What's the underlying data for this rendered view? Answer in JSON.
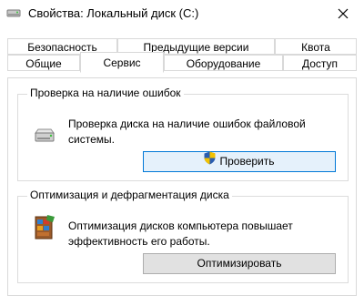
{
  "window": {
    "title": "Свойства: Локальный диск (C:)"
  },
  "tabs": {
    "row_back": [
      {
        "label": "Безопасность"
      },
      {
        "label": "Предыдущие версии"
      },
      {
        "label": "Квота"
      }
    ],
    "row_front": [
      {
        "label": "Общие"
      },
      {
        "label": "Сервис",
        "active": true
      },
      {
        "label": "Оборудование"
      },
      {
        "label": "Доступ"
      }
    ]
  },
  "check_group": {
    "legend": "Проверка на наличие ошибок",
    "description_line1": "Проверка диска на наличие ошибок файловой",
    "description_line2": "системы.",
    "button_label": "Проверить",
    "icon": "drive-icon"
  },
  "optimize_group": {
    "legend": "Оптимизация и дефрагментация диска",
    "description_line1": "Оптимизация дисков компьютера повышает",
    "description_line2": "эффективность его работы.",
    "button_label": "Оптимизировать",
    "icon": "defrag-icon"
  },
  "colors": {
    "accent": "#0078d7",
    "primary_button_bg": "#e5f1fb",
    "button_bg": "#e1e1e1"
  }
}
